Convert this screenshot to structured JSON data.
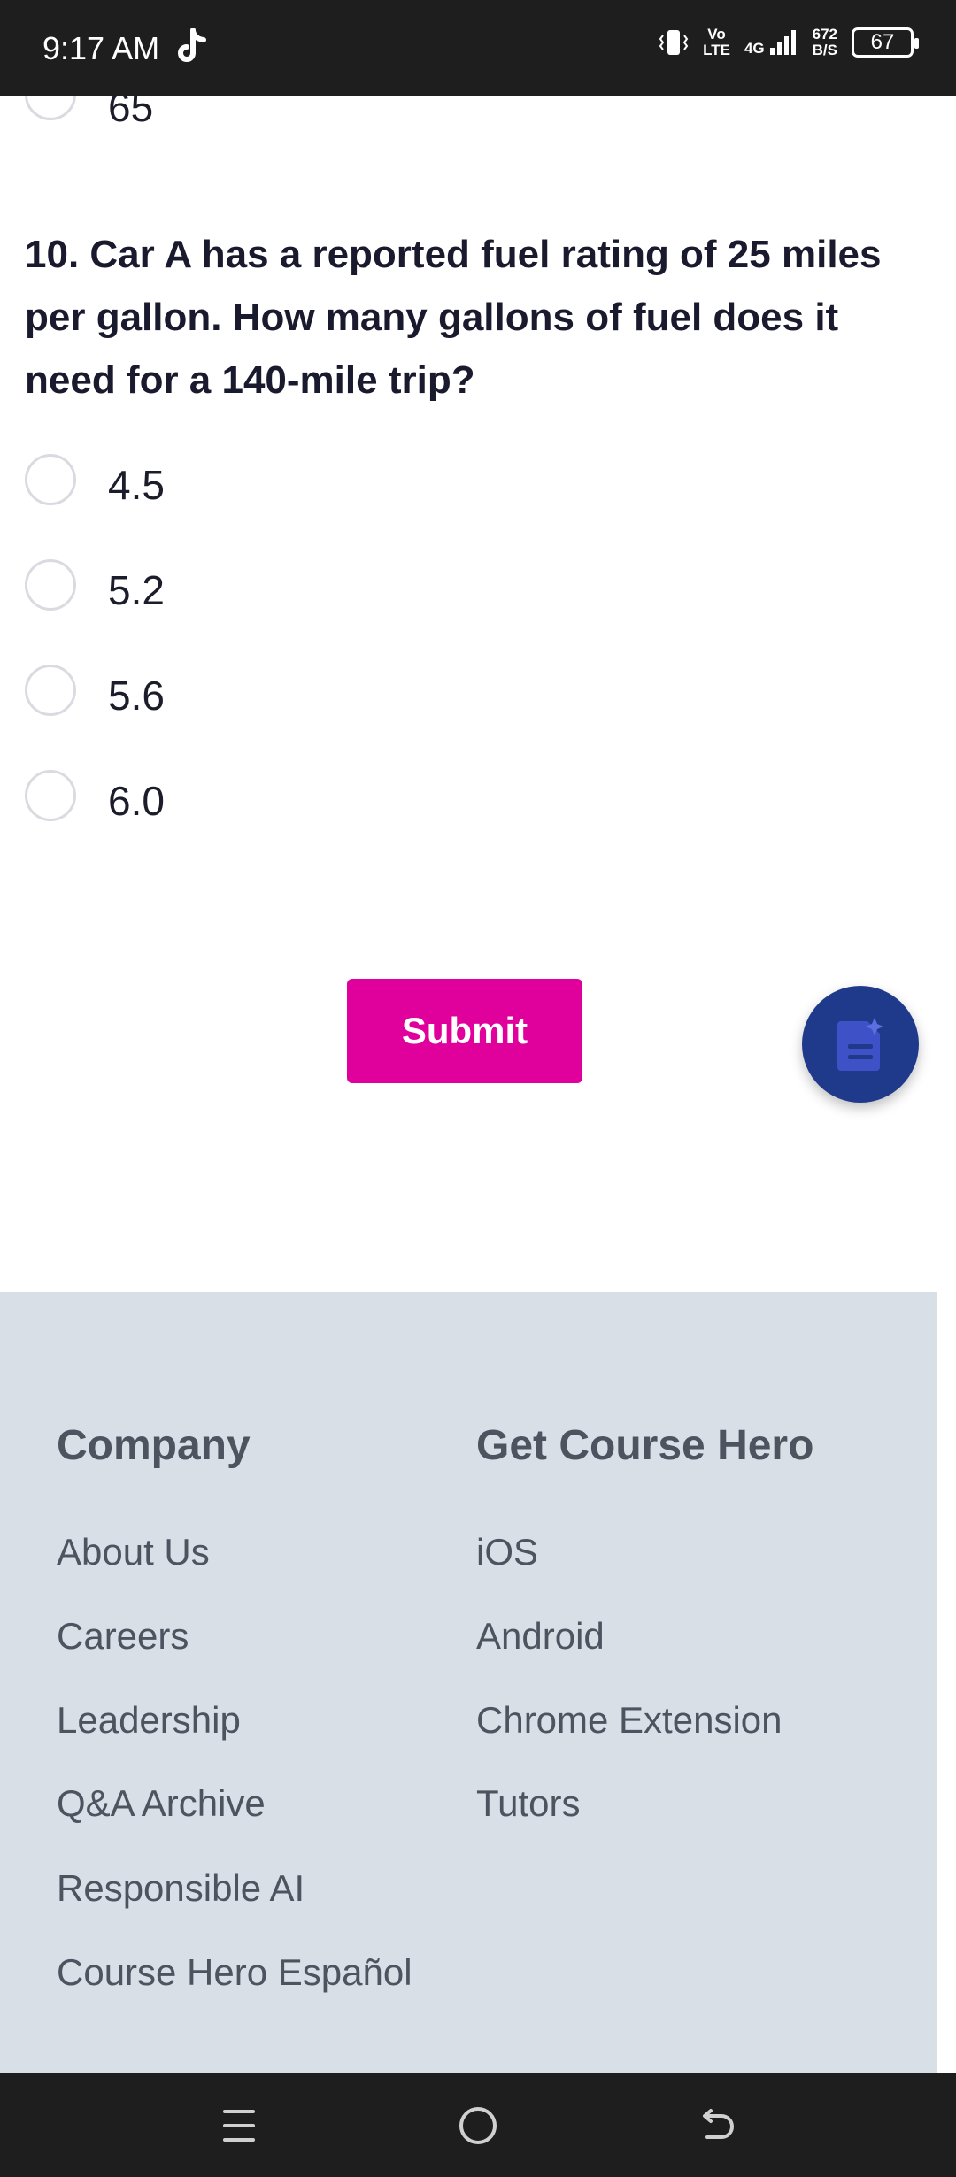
{
  "status_bar": {
    "time": "9:17 AM",
    "volte_top": "Vo",
    "volte_bottom": "LTE",
    "network": "4G",
    "speed_top": "672",
    "speed_bottom": "B/S",
    "battery": "67"
  },
  "previous_question": {
    "last_option": "65"
  },
  "question": {
    "text": "10. Car A has a reported fuel rating of 25 miles per gallon. How many gallons of fuel does it need for a 140-mile trip?",
    "options": [
      "4.5",
      "5.2",
      "5.6",
      "6.0"
    ]
  },
  "submit_label": "Submit",
  "fab_icon": "document-sparkle-icon",
  "footer": {
    "company": {
      "heading": "Company",
      "links": [
        "About Us",
        "Careers",
        "Leadership",
        "Q&A Archive",
        "Responsible AI",
        "Course Hero Español"
      ]
    },
    "get_course_hero": {
      "heading": "Get Course Hero",
      "links": [
        "iOS",
        "Android",
        "Chrome Extension",
        "Tutors"
      ]
    }
  },
  "colors": {
    "accent": "#e0009b",
    "fab": "#1f3a8a",
    "footer_bg": "#d9dfe6",
    "footer_text": "#4d5460"
  },
  "nav_icons": [
    "menu-icon",
    "home-icon",
    "back-icon"
  ]
}
